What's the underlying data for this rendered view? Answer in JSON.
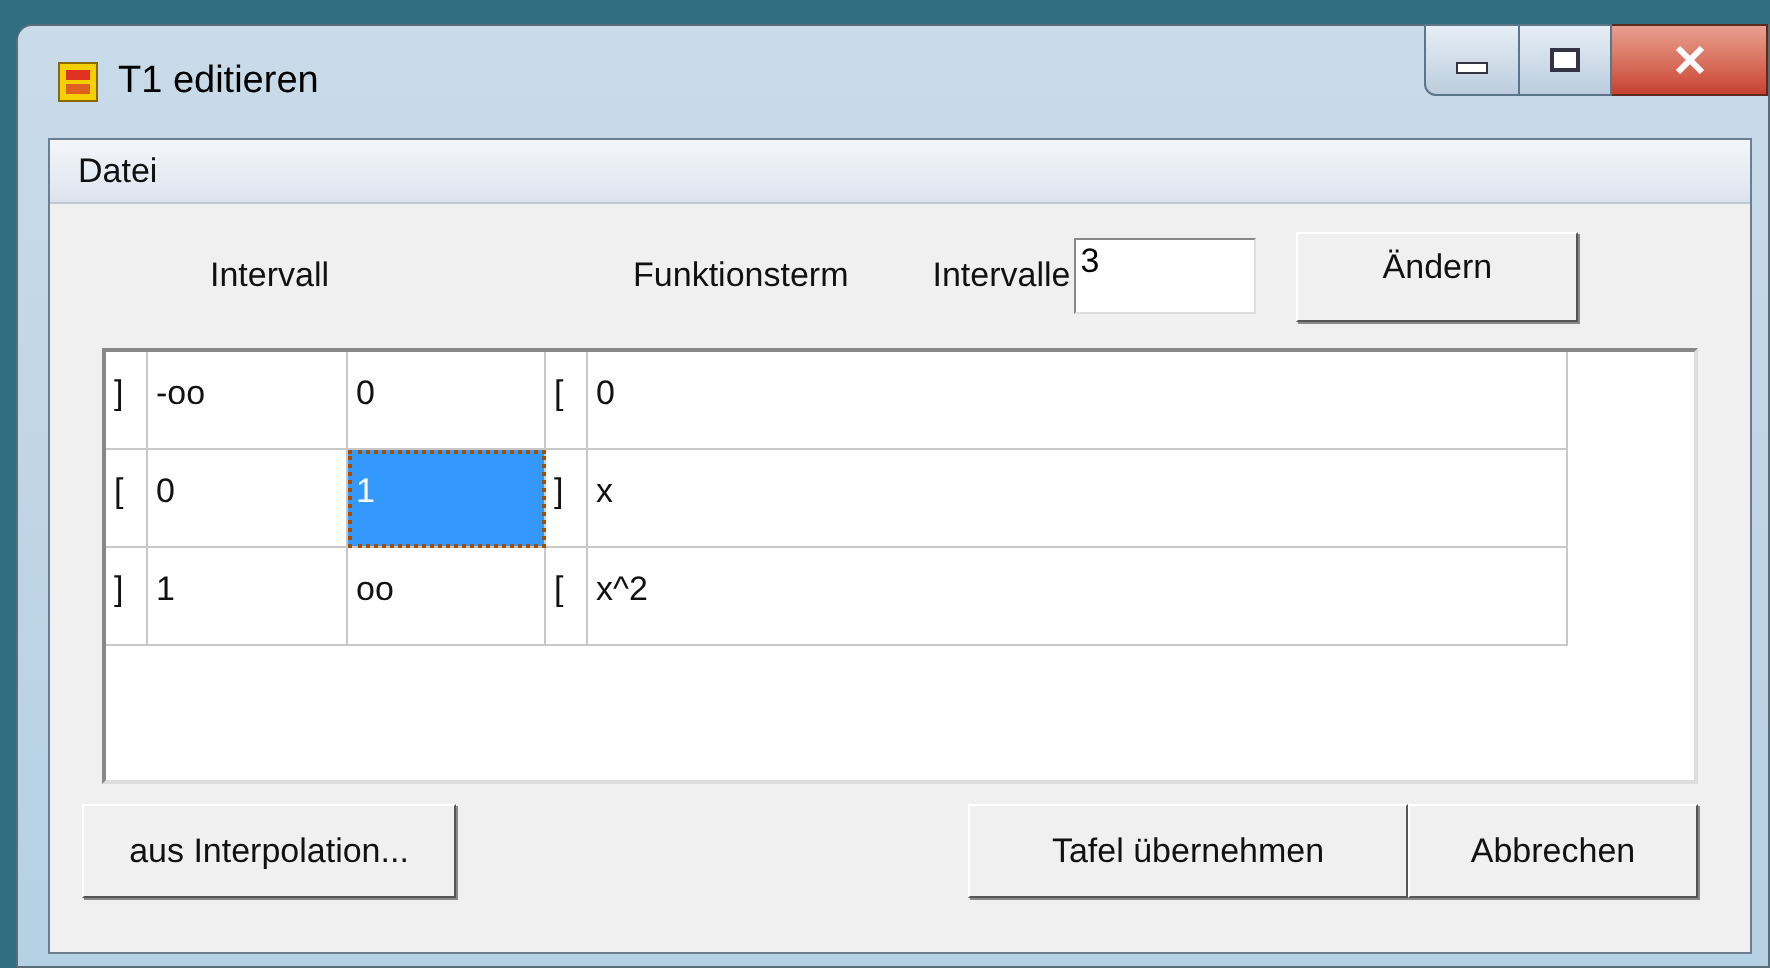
{
  "window": {
    "title": "T1 editieren"
  },
  "menu": [
    "Datei"
  ],
  "header": {
    "interval_label": "Intervall",
    "term_label": "Funktionsterm",
    "count_label": "Intervalle",
    "count_value": "3",
    "change_button": "Ändern"
  },
  "table": {
    "rows": [
      {
        "cells": [
          {
            "text": "]",
            "selected": false
          },
          {
            "text": "-oo",
            "selected": false
          },
          {
            "text": "0",
            "selected": false
          },
          {
            "text": "[",
            "selected": false
          },
          {
            "text": "0",
            "selected": false
          }
        ]
      },
      {
        "cells": [
          {
            "text": "[",
            "selected": false
          },
          {
            "text": "0",
            "selected": false
          },
          {
            "text": "1",
            "selected": true
          },
          {
            "text": "]",
            "selected": false
          },
          {
            "text": "x",
            "selected": false
          }
        ]
      },
      {
        "cells": [
          {
            "text": "]",
            "selected": false
          },
          {
            "text": "1",
            "selected": false
          },
          {
            "text": "oo",
            "selected": false
          },
          {
            "text": "[",
            "selected": false
          },
          {
            "text": "x^2",
            "selected": false
          }
        ]
      }
    ]
  },
  "buttons": {
    "left": "aus Interpolation...",
    "right": [
      "Tafel übernehmen",
      "Abbrechen"
    ]
  }
}
